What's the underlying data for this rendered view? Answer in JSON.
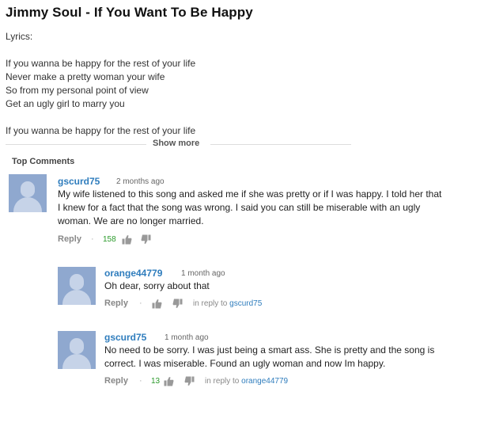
{
  "video": {
    "title": "Jimmy Soul - If You Want To Be Happy",
    "description_lines": [
      "Lyrics:",
      "",
      "If you wanna be happy for the rest of your life",
      "Never make a pretty woman your wife",
      "So from my personal point of view",
      "Get an ugly girl to marry you",
      "",
      "If you wanna be happy for the rest of your life"
    ],
    "show_more": "Show more"
  },
  "comments": {
    "section_title": "Top Comments",
    "items": [
      {
        "user": "gscurd75",
        "time": "2 months ago",
        "lines": [
          "My wife listened to this song and asked me if she was pretty or if I was happy. I told her that",
          "I knew for a fact that the song was wrong. I said you can still be miserable with an ugly",
          "woman. We are no longer married."
        ],
        "reply": "Reply",
        "separator": "·",
        "likes": "158",
        "in_reply_prefix": "",
        "in_reply_user": ""
      },
      {
        "user": "orange44779",
        "time": "1 month ago",
        "lines": [
          "Oh dear, sorry about that"
        ],
        "reply": "Reply",
        "separator": "·",
        "likes": "",
        "in_reply_prefix": "in reply to",
        "in_reply_user": "gscurd75"
      },
      {
        "user": "gscurd75",
        "time": "1 month ago",
        "lines": [
          "No need to be sorry. I was just being a smart ass. She is pretty and the song is",
          "correct. I was miserable. Found an ugly woman and now Im happy."
        ],
        "reply": "Reply",
        "separator": "·",
        "likes": "13",
        "in_reply_prefix": "in reply to",
        "in_reply_user": "orange44779"
      }
    ]
  },
  "colors": {
    "link": "#2f7dbd",
    "likes": "#2a9a2a",
    "avatar": "#8fa8cf"
  },
  "icons": [
    "thumbs-up-icon",
    "thumbs-down-icon",
    "default-avatar-icon"
  ]
}
